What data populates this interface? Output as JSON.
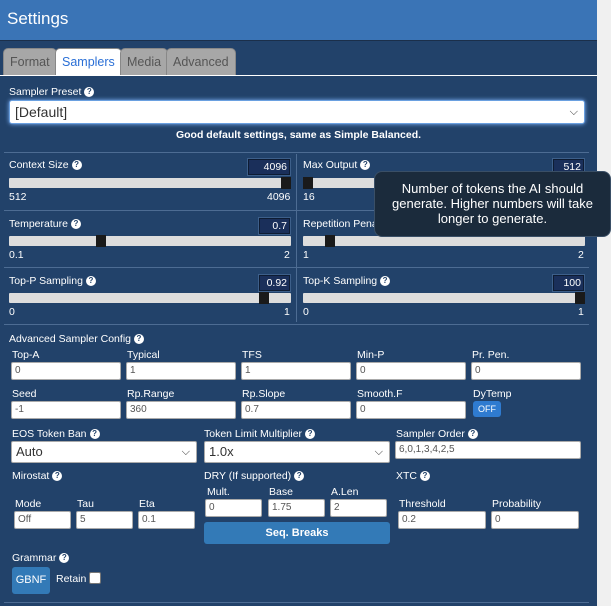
{
  "header": {
    "title": "Settings"
  },
  "tabs": [
    {
      "label": "Format",
      "active": false
    },
    {
      "label": "Samplers",
      "active": true
    },
    {
      "label": "Media",
      "active": false
    },
    {
      "label": "Advanced",
      "active": false
    }
  ],
  "preset": {
    "label": "Sampler Preset",
    "value": "[Default]",
    "description": "Good default settings, same as Simple Balanced."
  },
  "sliders": {
    "context_size": {
      "label": "Context Size",
      "value": "4096",
      "min": "512",
      "max": "4096",
      "fraction": 1.0
    },
    "max_output": {
      "label": "Max Output",
      "value": "512",
      "min": "16",
      "max": "",
      "fraction": 0.0
    },
    "temperature": {
      "label": "Temperature",
      "value": "0.7",
      "min": "0.1",
      "max": "2",
      "fraction": 0.32
    },
    "repetition_penalty": {
      "label": "Repetition Pena",
      "value": "",
      "min": "1",
      "max": "2",
      "fraction": 0.08
    },
    "top_p": {
      "label": "Top-P Sampling",
      "value": "0.92",
      "min": "0",
      "max": "1",
      "fraction": 0.92
    },
    "top_k": {
      "label": "Top-K Sampling",
      "value": "100",
      "min": "0",
      "max": "1",
      "fraction": 1.0
    }
  },
  "tooltip": {
    "text": "Number of tokens the AI should generate. Higher numbers will take longer to generate."
  },
  "advanced": {
    "title": "Advanced Sampler Config",
    "row1": [
      {
        "label": "Top-A",
        "value": "0"
      },
      {
        "label": "Typical",
        "value": "1"
      },
      {
        "label": "TFS",
        "value": "1"
      },
      {
        "label": "Min-P",
        "value": "0"
      },
      {
        "label": "Pr. Pen.",
        "value": "0"
      }
    ],
    "row2": [
      {
        "label": "Seed",
        "value": "-1"
      },
      {
        "label": "Rp.Range",
        "value": "360"
      },
      {
        "label": "Rp.Slope",
        "value": "0.7"
      },
      {
        "label": "Smooth.F",
        "value": "0"
      }
    ],
    "dytemp": {
      "label": "DyTemp",
      "state": "OFF"
    },
    "eos": {
      "label": "EOS Token Ban",
      "value": "Auto"
    },
    "token_limit": {
      "label": "Token Limit Multiplier",
      "value": "1.0x"
    },
    "sampler_order": {
      "label": "Sampler Order",
      "value": "6,0,1,3,4,2,5"
    }
  },
  "mirostat": {
    "label": "Mirostat",
    "mode": {
      "label": "Mode",
      "value": "Off"
    },
    "tau": {
      "label": "Tau",
      "value": "5"
    },
    "eta": {
      "label": "Eta",
      "value": "0.1"
    }
  },
  "dry": {
    "label": "DRY (If supported)",
    "mult": {
      "label": "Mult.",
      "value": "0"
    },
    "base": {
      "label": "Base",
      "value": "1.75"
    },
    "alen": {
      "label": "A.Len",
      "value": "2"
    },
    "button": "Seq. Breaks"
  },
  "xtc": {
    "label": "XTC",
    "threshold": {
      "label": "Threshold",
      "value": "0.2"
    },
    "probability": {
      "label": "Probability",
      "value": "0"
    }
  },
  "grammar": {
    "label": "Grammar",
    "button": "GBNF",
    "retain_label": "Retain"
  },
  "colors": {
    "header": "#3a74b6",
    "panel": "#22426a",
    "accent": "#2f7bd0"
  }
}
